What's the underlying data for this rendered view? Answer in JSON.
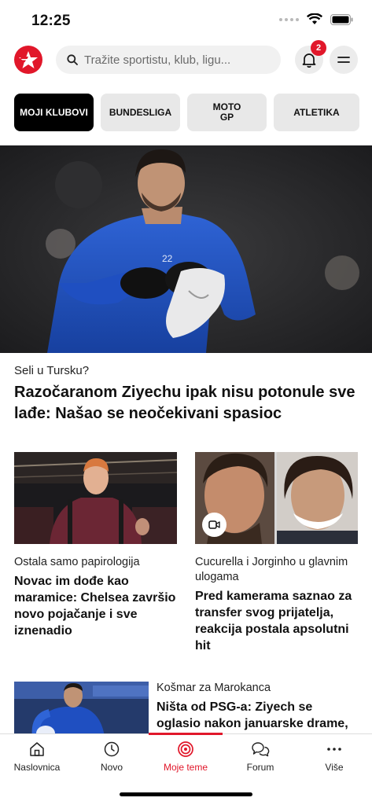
{
  "status_bar": {
    "time": "12:25"
  },
  "header": {
    "search_placeholder": "Tražite sportistu, klub, ligu...",
    "notification_count": "2"
  },
  "chips": [
    {
      "label": "MOJI KLUBOVI",
      "active": true
    },
    {
      "label": "BUNDESLIGA",
      "active": false
    },
    {
      "label": "MOTO\nGP",
      "active": false
    },
    {
      "label": "ATLETIKA",
      "active": false
    }
  ],
  "hero": {
    "kicker": "Seli u Tursku?",
    "title": "Razočaranom Ziyechu ipak nisu potonule sve lađe: Našao se neočekivani spasioc"
  },
  "cards": [
    {
      "kicker": "Ostala samo papirologija",
      "title": "Novac im dođe kao maramice: Chelsea završio novo pojačanje i sve iznenadio"
    },
    {
      "kicker": "Cucurella i Jorginho u glavnim ulogama",
      "title": "Pred kamerama saznao za transfer svog prijatelja, reakcija postala apsolutni hit",
      "video": true
    }
  ],
  "list_article": {
    "kicker": "Košmar za Marokanca",
    "title": "Ništa od PSG-a: Ziyech se oglasio nakon januarske drame,"
  },
  "bottom_nav": [
    {
      "label": "Naslovnica",
      "icon": "home-icon"
    },
    {
      "label": "Novo",
      "icon": "clock-icon"
    },
    {
      "label": "Moje teme",
      "icon": "target-icon",
      "active": true
    },
    {
      "label": "Forum",
      "icon": "chat-icon"
    },
    {
      "label": "Više",
      "icon": "more-icon"
    }
  ],
  "colors": {
    "accent": "#e1172a",
    "chip_bg": "#e8e8e8",
    "active_chip": "#000000",
    "hero_shirt": "#1f4fc1"
  }
}
